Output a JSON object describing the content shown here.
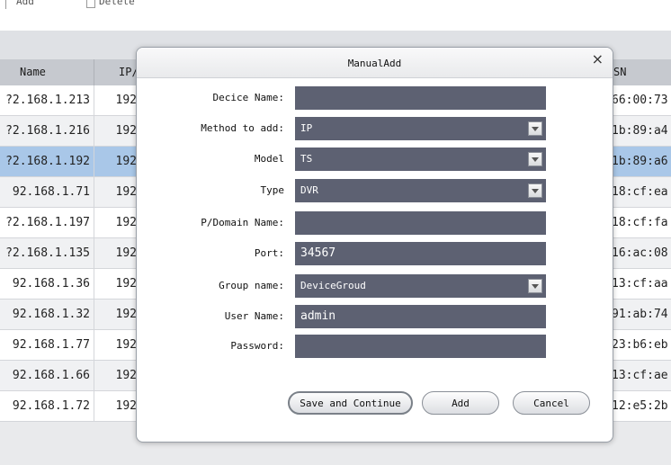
{
  "toolbar": {
    "add_label": "Add",
    "delete_label": "Delete"
  },
  "table": {
    "columns": [
      "Name",
      "IP/",
      "SN"
    ],
    "rows": [
      {
        "name": "?2.168.1.213",
        "ip": "192",
        "sn": "66:00:73",
        "selected": false
      },
      {
        "name": "?2.168.1.216",
        "ip": "192",
        "sn": "1b:89:a4",
        "selected": false
      },
      {
        "name": "?2.168.1.192",
        "ip": "192",
        "sn": "1b:89:a6",
        "selected": true
      },
      {
        "name": "92.168.1.71",
        "ip": "192",
        "sn": "18:cf:ea",
        "selected": false
      },
      {
        "name": "?2.168.1.197",
        "ip": "192",
        "sn": "18:cf:fa",
        "selected": false
      },
      {
        "name": "?2.168.1.135",
        "ip": "192",
        "sn": "16:ac:08",
        "selected": false
      },
      {
        "name": "92.168.1.36",
        "ip": "192",
        "sn": "13:cf:aa",
        "selected": false
      },
      {
        "name": "92.168.1.32",
        "ip": "192",
        "sn": "91:ab:74",
        "selected": false
      },
      {
        "name": "92.168.1.77",
        "ip": "192",
        "sn": "23:b6:eb",
        "selected": false
      },
      {
        "name": "92.168.1.66",
        "ip": "192",
        "sn": "13:cf:ae",
        "selected": false
      },
      {
        "name": "92.168.1.72",
        "ip": "192",
        "sn": "12:e5:2b",
        "selected": false
      }
    ]
  },
  "dialog": {
    "title": "ManualAdd",
    "close_icon": "×",
    "fields": {
      "device_name": {
        "label": "Decice Name:",
        "value": ""
      },
      "method": {
        "label": "Method to add:",
        "value": "IP"
      },
      "model": {
        "label": "Model",
        "value": "TS"
      },
      "type": {
        "label": "Type",
        "value": "DVR"
      },
      "domain": {
        "label": "P/Domain Name:",
        "value": ""
      },
      "port": {
        "label": "Port:",
        "value": "34567"
      },
      "group": {
        "label": "Group name:",
        "value": "DeviceGroud"
      },
      "user": {
        "label": "User Name:",
        "value": "admin"
      },
      "password": {
        "label": "Password:",
        "value": ""
      }
    },
    "buttons": {
      "save_continue": "Save and Continue",
      "add": "Add",
      "cancel": "Cancel"
    }
  },
  "colors": {
    "field_bg": "#5d6172",
    "selected_row": "#a9c7e8",
    "header_bg": "#c6c9cf"
  },
  "icons": {
    "add": "separator-bar",
    "delete": "trash-icon",
    "dropdown": "chevron-down-icon",
    "close": "close-icon"
  }
}
